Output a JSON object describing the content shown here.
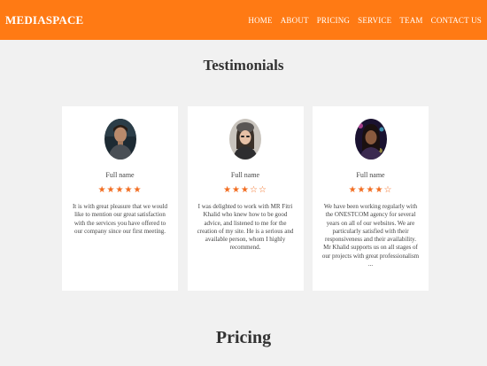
{
  "brand": "MEDIASPACE",
  "nav": [
    "HOME",
    "ABOUT",
    "PRICING",
    "SERVICE",
    "TEAM",
    "CONTACT US"
  ],
  "testimonials_title": "Testimonials",
  "testimonials": [
    {
      "name": "Full name",
      "rating": 5,
      "text": "It is with great pleasure that we would like to mention our great satisfaction with the services you have offered to our company since our first meeting."
    },
    {
      "name": "Full name",
      "rating": 3,
      "text": "I was delighted to work with MR Fitri Khalid who knew how to be good advice, and listened to me for the creation of my site. He is a serious and available person, whom I highly recommend."
    },
    {
      "name": "Full name",
      "rating": 4,
      "text": "We have been working regularly with the ONESTCOM agency for several years on all of our websites. We are particularly satisfied with their responsiveness and their availability. Mr Khalid supports us on all stages of our projects with great professionalism ..."
    }
  ],
  "pricing_title": "Pricing",
  "colors": {
    "accent": "#ff7a14",
    "star": "#f26d21",
    "background": "#f1f1f1",
    "card": "#ffffff"
  }
}
